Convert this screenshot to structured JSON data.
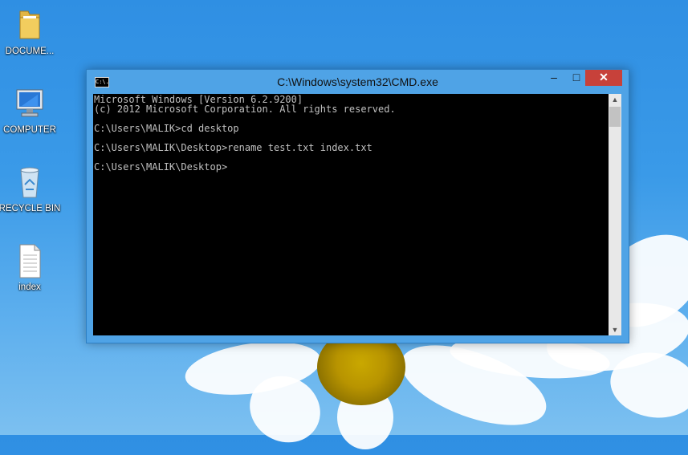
{
  "desktop": {
    "icons": [
      {
        "label": "DOCUME..."
      },
      {
        "label": "COMPUTER"
      },
      {
        "label": "RECYCLE BIN"
      },
      {
        "label": "index"
      }
    ]
  },
  "window": {
    "title": "C:\\Windows\\system32\\CMD.exe",
    "icon_text": "C:\\.",
    "min_symbol": "–",
    "max_symbol": "□",
    "close_symbol": "✕"
  },
  "console": {
    "text": "Microsoft Windows [Version 6.2.9200]\n(c) 2012 Microsoft Corporation. All rights reserved.\n\nC:\\Users\\MALIK>cd desktop\n\nC:\\Users\\MALIK\\Desktop>rename test.txt index.txt\n\nC:\\Users\\MALIK\\Desktop>"
  },
  "colors": {
    "close_button": "#c7413a",
    "window_frame": "#4fa3e6",
    "console_bg": "#000000"
  }
}
